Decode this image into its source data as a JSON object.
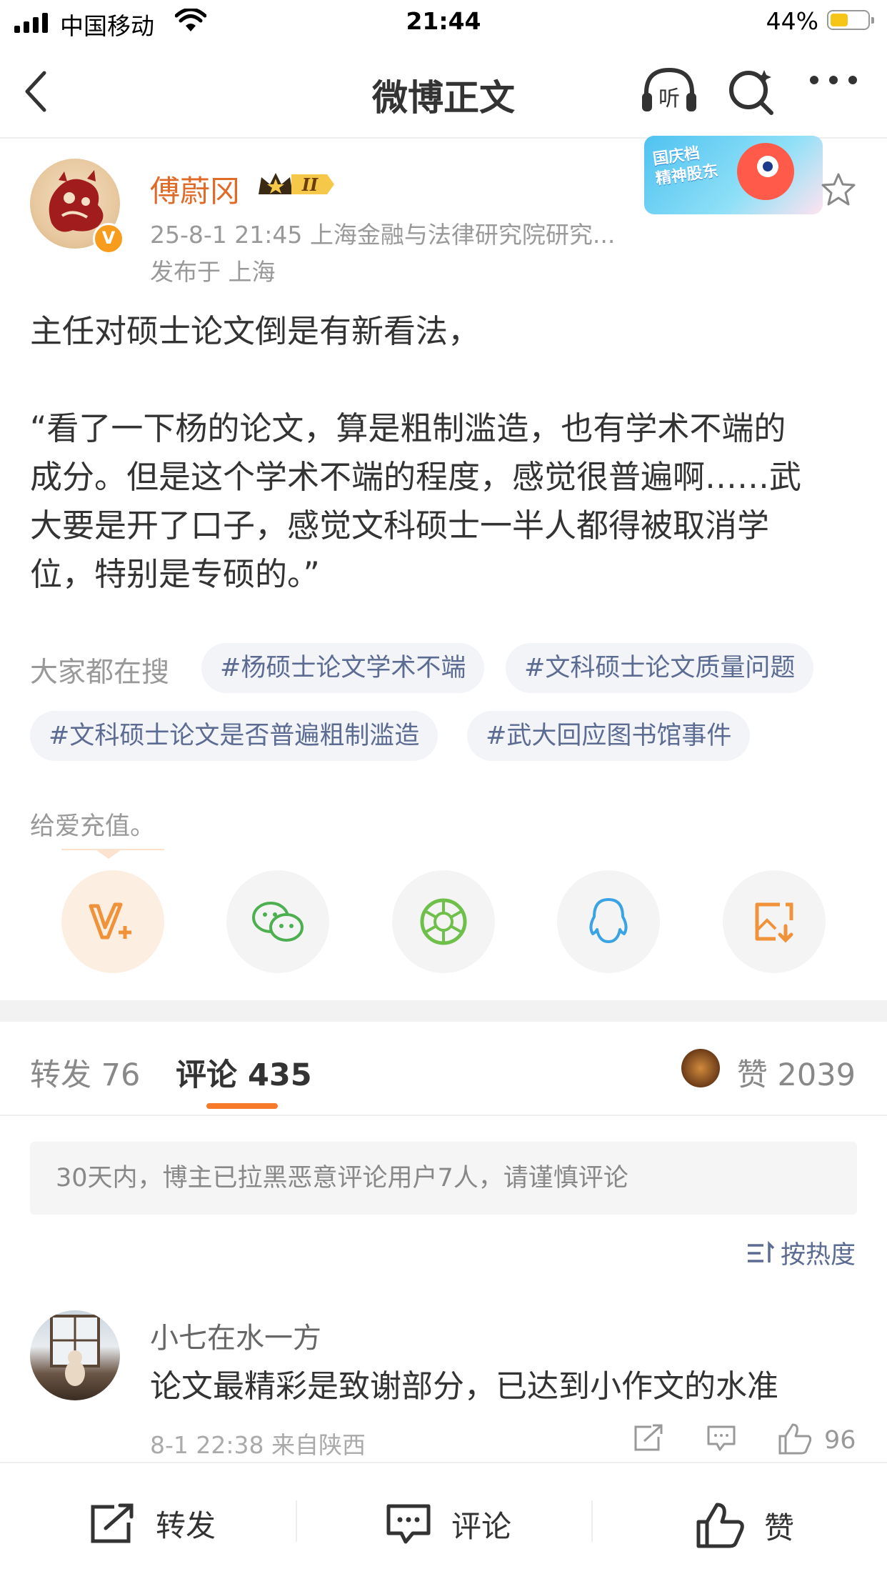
{
  "status_bar": {
    "carrier": "中国移动",
    "time": "21:44",
    "battery": "44%"
  },
  "nav": {
    "title": "微博正文",
    "listen_label": "听"
  },
  "post": {
    "author": "傅蔚冈",
    "verified_mark": "V",
    "level_badge": "II",
    "meta": "25-8-1 21:45  上海金融与法律研究院研究...",
    "location": "发布于 上海",
    "promo_text_line1": "国庆档",
    "promo_text_line2": "精神股东",
    "content": [
      "主任对硕士论文倒是有新看法，",
      "“看了一下杨的论文，算是粗制滥造，也有学术不端的",
      "成分。但是这个学术不端的程度，感觉很普遍啊……武",
      "大要是开了口子，感觉文科硕士一半人都得被取消学",
      "位，特别是专硕的。”"
    ]
  },
  "search": {
    "label": "大家都在搜",
    "tags": [
      "#杨硕士论文学术不端",
      "#文科硕士论文质量问题",
      "#文科硕士论文是否普遍粗制滥造",
      "#武大回应图书馆事件"
    ]
  },
  "charge_text": "给爱充值。",
  "share_icons": [
    "vip-charge-icon",
    "wechat-icon",
    "moments-icon",
    "qq-icon",
    "save-image-icon"
  ],
  "tabs": {
    "repost": "转发 76",
    "comment": "评论 435",
    "likes": "赞 2039"
  },
  "notice": "30天内，博主已拉黑恶意评论用户7人，请谨慎评论",
  "sort_label": "按热度",
  "comments": [
    {
      "user": "小七在水一方",
      "text": "论文最精彩是致谢部分，已达到小作文的水准",
      "time": "8-1 22:38  来自陕西",
      "likes": "96"
    }
  ],
  "toolbar": {
    "repost": "转发",
    "comment": "评论",
    "like": "赞"
  },
  "colors": {
    "accent_orange": "#f77a2a",
    "author_name": "#e06a28",
    "tag_text": "#5b6b92"
  }
}
